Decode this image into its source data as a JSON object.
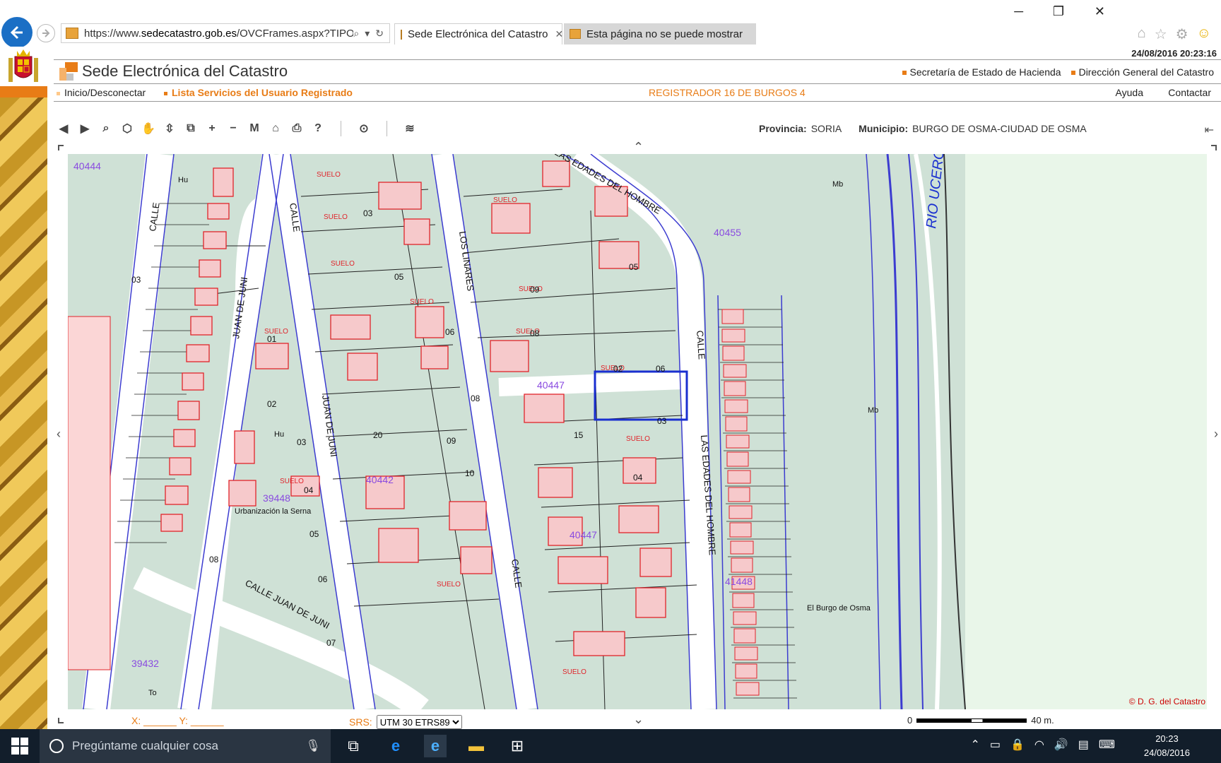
{
  "browser": {
    "url_prefix": "https://www.",
    "url_domain": "sedecatastro.gob.es",
    "url_path": "/OVCFrames.aspx?TIPO=l",
    "tabs": [
      {
        "label": "Sede Electrónica del Catastro",
        "active": true
      },
      {
        "label": "Esta página no se puede mostrar",
        "active": false
      }
    ]
  },
  "header": {
    "datetime": "24/08/2016  20:23:16",
    "site_title": "Sede Electrónica del Catastro",
    "links": [
      "Secretaría de Estado de Hacienda",
      "Dirección General del Catastro"
    ]
  },
  "nav": {
    "login": "Inicio/Desconectar",
    "services": "Lista Servicios del Usuario Registrado",
    "user": "REGISTRADOR 16 DE BURGOS 4",
    "help": "Ayuda",
    "contact": "Contactar"
  },
  "location": {
    "province_label": "Provincia:",
    "province": "SORIA",
    "municipality_label": "Municipio:",
    "municipality": "BURGO DE OSMA-CIUDAD DE OSMA"
  },
  "map": {
    "streets": [
      "CALLE",
      "JUAN DE JUNI",
      "CALLE",
      "JUAN DE JUNI",
      "LOS LINARES",
      "CALLE",
      "LAS EDADES DEL HOMBRE",
      "CALLE",
      "LAS EDADES DEL HOMBRE",
      "CALLE JUAN DE JUNI"
    ],
    "river": "RIO UCERO",
    "parcels_blue": [
      "40444",
      "39448",
      "40442",
      "40447",
      "40447",
      "40455",
      "39432",
      "41448"
    ],
    "place": "El Burgo de Osma",
    "area": "Urbanización la Serna",
    "labels": {
      "suelo": "SUELO",
      "mb": "Mb",
      "hu": "Hu",
      "to": "To"
    },
    "copyright": "© D. G. del Catastro"
  },
  "footer": {
    "x_label": "X:",
    "y_label": "Y:",
    "srs_label": "SRS:",
    "srs_value": "UTM 30 ETRS89",
    "scale_left": "0",
    "scale_right": "40 m."
  },
  "taskbar": {
    "search_placeholder": "Pregúntame cualquier cosa",
    "time": "20:23",
    "date": "24/08/2016"
  },
  "colors": {
    "accent": "#e87c16",
    "map_bg": "#cfe1d6",
    "parcel_red": "#e0242b",
    "street_blue": "#3c3cd0"
  }
}
